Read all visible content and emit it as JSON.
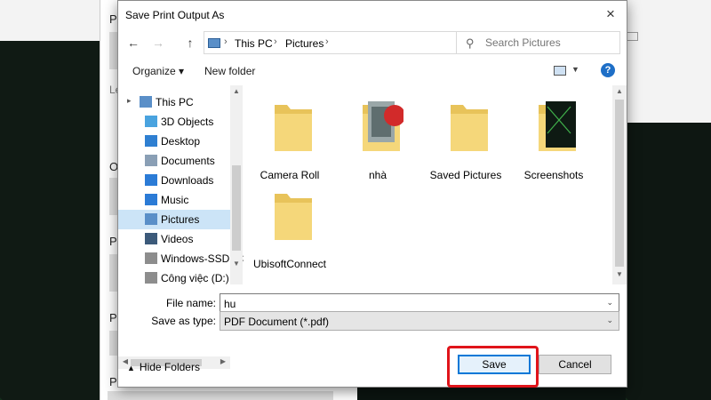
{
  "background": {
    "print_panel_labels": [
      "P",
      "Le",
      "O",
      "Pa",
      "Ph",
      "Pa"
    ]
  },
  "dialog": {
    "title": "Save Print Output As",
    "close_icon": "×",
    "nav": {
      "back": "←",
      "forward": "→",
      "up": "↑",
      "breadcrumb": [
        "This PC",
        "Pictures"
      ],
      "breadcrumb_sep": "›",
      "refresh": "↻",
      "search_placeholder": "Search Pictures"
    },
    "toolbar": {
      "organize": "Organize ▾",
      "new_folder": "New folder",
      "help": "?"
    },
    "nav_pane": {
      "items": [
        {
          "label": "This PC",
          "icon": "computer-icon",
          "color": "#5a8fc8"
        },
        {
          "label": "3D Objects",
          "icon": "cube-icon",
          "color": "#4aa3df"
        },
        {
          "label": "Desktop",
          "icon": "desktop-icon",
          "color": "#2f7fd1"
        },
        {
          "label": "Documents",
          "icon": "document-icon",
          "color": "#8a9fb5"
        },
        {
          "label": "Downloads",
          "icon": "download-icon",
          "color": "#2b7bd6"
        },
        {
          "label": "Music",
          "icon": "music-icon",
          "color": "#2b7bd6"
        },
        {
          "label": "Pictures",
          "icon": "pictures-icon",
          "color": "#5a8fc8",
          "selected": true
        },
        {
          "label": "Videos",
          "icon": "video-icon",
          "color": "#3c5a7a"
        },
        {
          "label": "Windows-SSD (C",
          "icon": "drive-icon",
          "color": "#8d8d8d"
        },
        {
          "label": "Công việc (D:)",
          "icon": "drive-icon",
          "color": "#8d8d8d"
        }
      ]
    },
    "files": [
      {
        "label": "Camera Roll",
        "icon": "folder-icon"
      },
      {
        "label": "nhà",
        "icon": "photo-folder-icon"
      },
      {
        "label": "Saved Pictures",
        "icon": "folder-icon"
      },
      {
        "label": "Screenshots",
        "icon": "screenshot-folder-icon"
      },
      {
        "label": "UbisoftConnect",
        "icon": "folder-icon"
      }
    ],
    "file_name_label": "File name:",
    "file_name_value": "hu",
    "save_as_type_label": "Save as type:",
    "save_as_type_value": "PDF Document (*.pdf)",
    "hide_folders": "Hide Folders",
    "save_button": "Save",
    "cancel_button": "Cancel"
  },
  "colors": {
    "folder_yellow": "#f5d77a",
    "selection_blue": "#cce4f7",
    "primary_border": "#0078d7",
    "highlight_red": "#e0141a"
  }
}
